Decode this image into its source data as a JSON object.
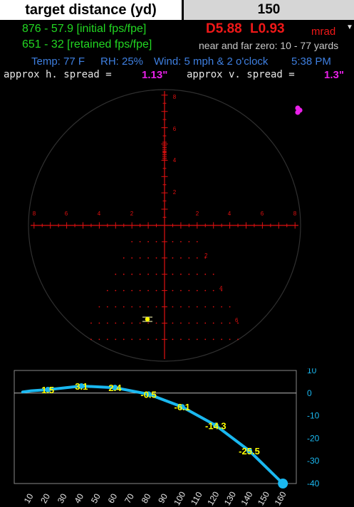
{
  "header": {
    "target_label": "target distance (yd)",
    "target_value": "150"
  },
  "info": {
    "initial": "876 - 57.9 [initial fps/fpe]",
    "retained": "651 - 32 [retained fps/fpe]",
    "dial": "D5.88",
    "lead": "L0.93",
    "unit": "mrad",
    "near_far": "near and far zero: 10  -  77 yards",
    "temp": "Temp: 77 F",
    "rh": "RH: 25%",
    "wind": "Wind: 5 mph & 2 o'clock",
    "time": "5:38 PM",
    "h_spread_label": "approx h. spread =",
    "h_spread_value": "1.13\"",
    "v_spread_label": "approx v. spread =",
    "v_spread_value": "1.3\""
  },
  "reticle": {
    "left_labels": [
      "8",
      "6",
      "4",
      "2"
    ],
    "right_labels": [
      "2",
      "4",
      "6",
      "8"
    ],
    "up_labels": [
      "8",
      "6",
      "4",
      "2"
    ],
    "tree_labels": [
      "2",
      "4",
      "6"
    ]
  },
  "chart_data": {
    "type": "line",
    "x": [
      5,
      10,
      20,
      40,
      60,
      80,
      100,
      120,
      140,
      160
    ],
    "y": [
      0.5,
      1.0,
      1.5,
      3.1,
      2.4,
      -0.5,
      -6.1,
      -14.3,
      -25.5,
      -40
    ],
    "data_labels": [
      {
        "x": 20,
        "y": 1.5,
        "label": "1.5"
      },
      {
        "x": 40,
        "y": 3.1,
        "label": "3.1"
      },
      {
        "x": 60,
        "y": 2.4,
        "label": "2.4"
      },
      {
        "x": 80,
        "y": -0.5,
        "label": "-0.5"
      },
      {
        "x": 100,
        "y": -6.1,
        "label": "-6.1"
      },
      {
        "x": 120,
        "y": -14.3,
        "label": "-14.3"
      },
      {
        "x": 140,
        "y": -25.5,
        "label": "-25.5"
      }
    ],
    "xticks": [
      10,
      20,
      30,
      40,
      50,
      60,
      70,
      80,
      90,
      100,
      110,
      120,
      130,
      140,
      150,
      160
    ],
    "yticks": [
      10,
      0,
      -10,
      -20,
      -30,
      -40
    ],
    "xlim": [
      0,
      168
    ],
    "ylim": [
      -40,
      10
    ],
    "colors": {
      "line": "#1ab8f0",
      "label_text": "#ffff00",
      "axis": "#1ab8f0",
      "zero": "#bbbbbb"
    }
  }
}
